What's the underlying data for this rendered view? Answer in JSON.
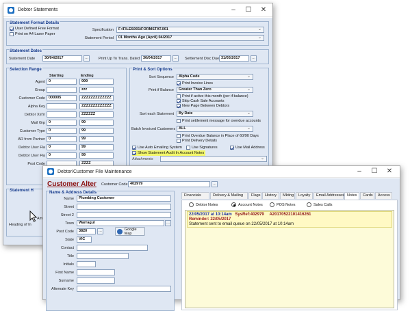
{
  "ds": {
    "title": "Debtor Statements",
    "format_group": "Statement Format Details",
    "user_defined_label": "User Defined Free Format",
    "print_a4_label": "Print on A4 Laser Paper",
    "specification_label": "Specification",
    "specification_value": "F:\\FILES001\\FORMSTAT.001",
    "period_label": "Statement Period",
    "period_value": "01 Months Ago (April) 04/2017",
    "dates_group": "Statement Dates",
    "stmt_date_label": "Statement Date",
    "stmt_date_value": "30/04/2017",
    "print_upto_label": "Print Up To Trans. Dated",
    "print_upto_value": "30/04/2017",
    "settle_label": "Settlement Disc Due",
    "settle_value": "31/05/2017",
    "selection_group": "Selection Range",
    "starting_header": "Starting",
    "ending_header": "Ending",
    "ranges": [
      {
        "label": "Agent",
        "start": "0",
        "end": "999"
      },
      {
        "label": "Group",
        "start": "",
        "end": "zzz"
      },
      {
        "label": "Customer Code",
        "start": "000005",
        "end": "ZZZZZZZZZZZZZ"
      },
      {
        "label": "Alpha Key",
        "start": "",
        "end": "ZZZZZZZZZZZZZ"
      },
      {
        "label": "Debtor Xst'n",
        "start": "",
        "end": "ZZZZZZ"
      },
      {
        "label": "Mail Grp",
        "start": "0",
        "end": "99"
      },
      {
        "label": "Customer Type",
        "start": "0",
        "end": "99"
      },
      {
        "label": "AR from Partner",
        "start": "0",
        "end": "99"
      },
      {
        "label": "Debtor User Fla",
        "start": "0",
        "end": "99"
      },
      {
        "label": "Debtor User Fla",
        "start": "0",
        "end": "99"
      },
      {
        "label": "Post Code",
        "start": "",
        "end": "ZZZZ"
      }
    ],
    "print_group": "Print & Sort Options",
    "sort_label": "Sort Sequence",
    "sort_value": "Alpha Code",
    "print_invoice_lines": "Print Invoice Lines",
    "print_if_balance_label": "Print if Balance",
    "print_if_balance_value": "Greater Than Zero",
    "print_if_active": "Print if active this month (per if balance)",
    "skip_cash": "Skip Cash Sale Accounts",
    "new_page": "New Page Between Debtors",
    "sort_each_label": "Sort each Statement",
    "sort_each_value": "By Date",
    "print_settlement": "Print settlement message for overdue accounts",
    "batch_label": "Batch Invoiced Customers",
    "batch_value": "ALL",
    "print_overdue": "Print Overdue Balance in Place of 60/90 Days",
    "print_delivery": "Print Delivery Details",
    "auto_email": "Use Auto Emailing System",
    "use_signatures": "Use Signatures",
    "use_mail_address": "Use Mail Address",
    "show_audit": "Show Statement Audit In Account Notes",
    "attachments_label": "Attachments",
    "stmt_h_group": "Statement H",
    "amount_label": "Amou",
    "heading_label": "Heading of In"
  },
  "cfm": {
    "title": "Debtor/Customer File Maintenance",
    "mode_title": "Customer Alter",
    "code_label": "Customer Code",
    "code_value": "402979",
    "name_group": "Name & Address Details",
    "name_label": "Name",
    "name_value": "Plumbing Customer",
    "street_label": "Street",
    "street2_label": "Street 2",
    "town_label": "Town",
    "town_value": "Warragul",
    "postcode_label": "Post Code",
    "postcode_value": "3820",
    "google_map": "Google Map",
    "state_label": "State",
    "state_value": "VIC",
    "contact_label": "Contact",
    "title_label": "Title",
    "initials_label": "Initials",
    "first_name_label": "First Name",
    "surname_label": "Surname",
    "alt_key_label": "Alternate Key",
    "tabs": [
      "Financials",
      "Delivery & Mailing",
      "Flags",
      "History",
      "Mkting",
      "Loyalty",
      "Email Addresses",
      "Notes",
      "Cards",
      "Access"
    ],
    "radios": [
      "Debtor Notes",
      "Account Notes",
      "POS Notes",
      "Sales Calls"
    ],
    "note_line1": "22/05/2017 at 10:14am",
    "note_sysref": "SysRef:402979",
    "note_ref": "A20170522101416261",
    "note_reminder": "Reminder: 22/05/2017",
    "note_text": "Statement sent to email queue on 22/05/2017 at 10:14am"
  },
  "colors": {
    "accent": "#163b8c",
    "highlight": "#f3f76a",
    "note_bg": "#fdfbd9"
  }
}
